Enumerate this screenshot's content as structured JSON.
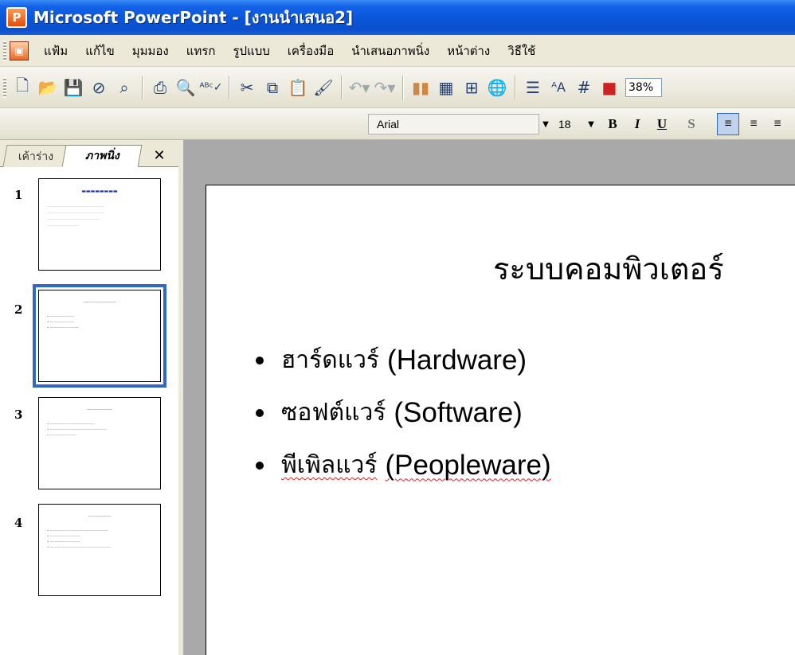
{
  "window": {
    "title": "Microsoft PowerPoint - [งานนำเสนอ2]",
    "app_icon_glyph": "P"
  },
  "menu": [
    "แฟ้ม",
    "แก้ไข",
    "มุมมอง",
    "แทรก",
    "รูปแบบ",
    "เครื่องมือ",
    "นำเสนอภาพนิ่ง",
    "หน้าต่าง",
    "วิธีใช้"
  ],
  "toolbar": {
    "zoom": "38%"
  },
  "format": {
    "font": "Arial",
    "size": "18",
    "bold": "B",
    "italic": "I",
    "underline": "U",
    "shadow": "S"
  },
  "panel": {
    "tab_outline": "เค้าร่าง",
    "tab_slides": "ภาพนิ่ง",
    "close": "✕",
    "thumbnails": [
      {
        "number": "1"
      },
      {
        "number": "2"
      },
      {
        "number": "3"
      },
      {
        "number": "4"
      }
    ]
  },
  "slide": {
    "title": "ระบบคอมพิวเตอร์",
    "bullets": [
      {
        "thai": "ฮาร์ดแวร์",
        "eng": "(Hardware)"
      },
      {
        "thai": "ซอฟต์แวร์",
        "eng": "(Software)"
      },
      {
        "thai": "พีเพิลแวร์",
        "eng": "(Peopleware)"
      }
    ]
  },
  "colors": {
    "titlebar": "#0a55d8",
    "selection": "#3168c6",
    "workspace": "#a9a9a9"
  }
}
